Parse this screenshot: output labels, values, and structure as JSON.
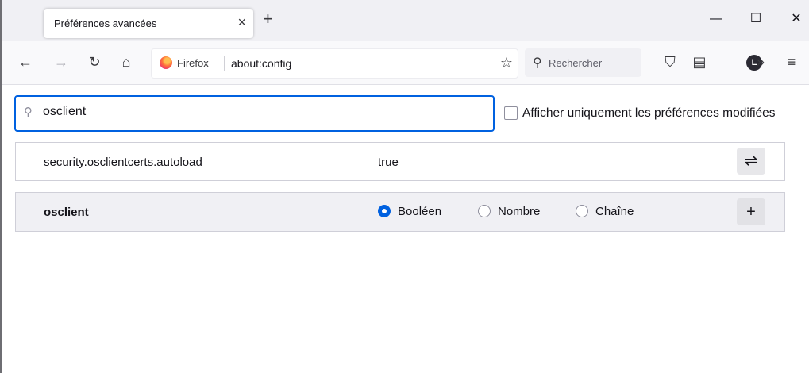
{
  "tab": {
    "title": "Préférences avancées",
    "close_icon": "×",
    "new_tab_icon": "+"
  },
  "window_controls": {
    "minimize": "—",
    "maximize": "☐",
    "close": "✕"
  },
  "nav": {
    "back": "←",
    "forward": "→",
    "reload": "↻",
    "home": "⌂",
    "identity_label": "Firefox",
    "url": "about:config",
    "bookmark_icon": "☆",
    "search_placeholder": "Rechercher",
    "search_icon": "⚲",
    "pocket_icon": "⛉",
    "reader_icon": "▤",
    "account_initial": "L",
    "overflow_icon": "»",
    "menu_icon": "≡"
  },
  "config": {
    "search_value": "osclient",
    "search_icon": "⚲",
    "show_modified_label": "Afficher uniquement les préférences modifiées",
    "show_modified_checked": false
  },
  "preferences": [
    {
      "name": "security.osclientcerts.autoload",
      "value": "true",
      "action_icon": "⇌"
    }
  ],
  "new_pref": {
    "name": "osclient",
    "types": [
      {
        "label": "Booléen",
        "checked": true
      },
      {
        "label": "Nombre",
        "checked": false
      },
      {
        "label": "Chaîne",
        "checked": false
      }
    ],
    "add_icon": "+"
  },
  "colors": {
    "accent": "#0061e0",
    "tabstrip": "#f0f0f4",
    "toolbar": "#f9f9fb"
  }
}
